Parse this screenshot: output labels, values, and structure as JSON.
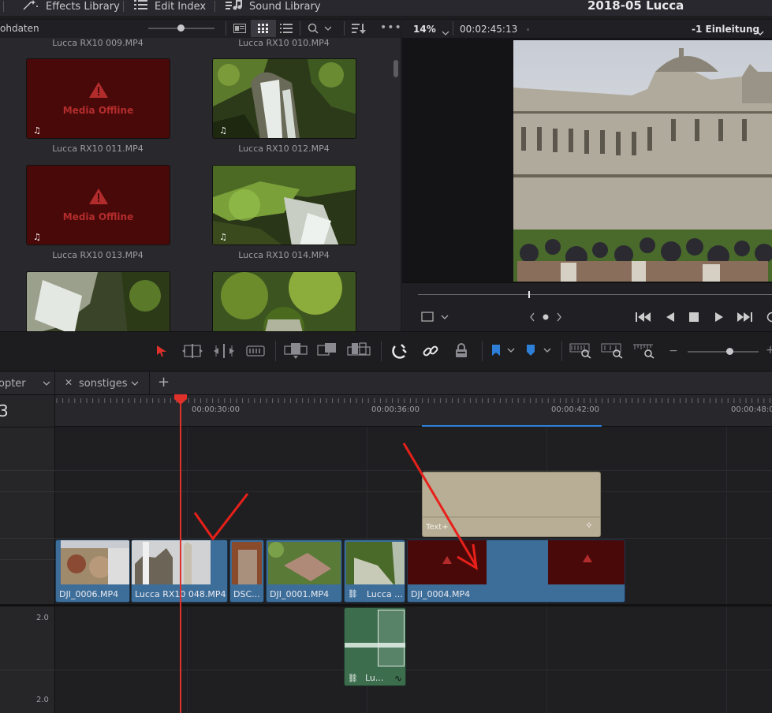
{
  "topbar": {
    "effects_library": "Effects Library",
    "edit_index": "Edit Index",
    "sound_library": "Sound Library",
    "project_title": "2018-05 Lucca"
  },
  "media_pool": {
    "bin_name": "ohdaten",
    "clips": [
      {
        "name": "Lucca  RX10 009.MP4",
        "offline": false,
        "partial": true
      },
      {
        "name": "Lucca  RX10 010.MP4",
        "offline": false,
        "partial": true
      },
      {
        "name": "Lucca  RX10 011.MP4",
        "offline": true
      },
      {
        "name": "Lucca  RX10 012.MP4",
        "offline": false
      },
      {
        "name": "Lucca  RX10 013.MP4",
        "offline": true
      },
      {
        "name": "Lucca  RX10 014.MP4",
        "offline": false
      },
      {
        "name": "",
        "offline": false
      },
      {
        "name": "",
        "offline": false
      }
    ],
    "offline_text": "Media Offline"
  },
  "viewer": {
    "zoom": "14%",
    "timecode": "00:02:45:13",
    "timeline_name": "-1 Einleitung"
  },
  "tabs": {
    "tab1": "opter",
    "tab2": "sonstiges",
    "close_glyph": "✕",
    "add_glyph": "+"
  },
  "timeline": {
    "track_number": "3",
    "ticks": [
      "00:00:30:00",
      "00:00:36:00",
      "00:00:42:00",
      "00:00:48:0"
    ],
    "audio_level_1": "2.0",
    "audio_level_2": "2.0",
    "text_clip_label": "Text+",
    "video_clips": [
      {
        "name": "DJI_0006.MP4"
      },
      {
        "name": "Lucca  RX10 048.MP4"
      },
      {
        "name": "DSC..."
      },
      {
        "name": "DJI_0001.MP4"
      },
      {
        "name": "Lucca ..."
      },
      {
        "name": "DJI_0004.MP4"
      }
    ],
    "audio_clip": {
      "name": "Lu..."
    }
  },
  "colors": {
    "accent_blue": "#2d7fd8",
    "playhead_red": "#e0302a",
    "clip_blue": "#3d6e9a",
    "audio_green": "#3c6e4e",
    "text_clip": "#b8ae96",
    "offline_red": "#4a0909"
  }
}
